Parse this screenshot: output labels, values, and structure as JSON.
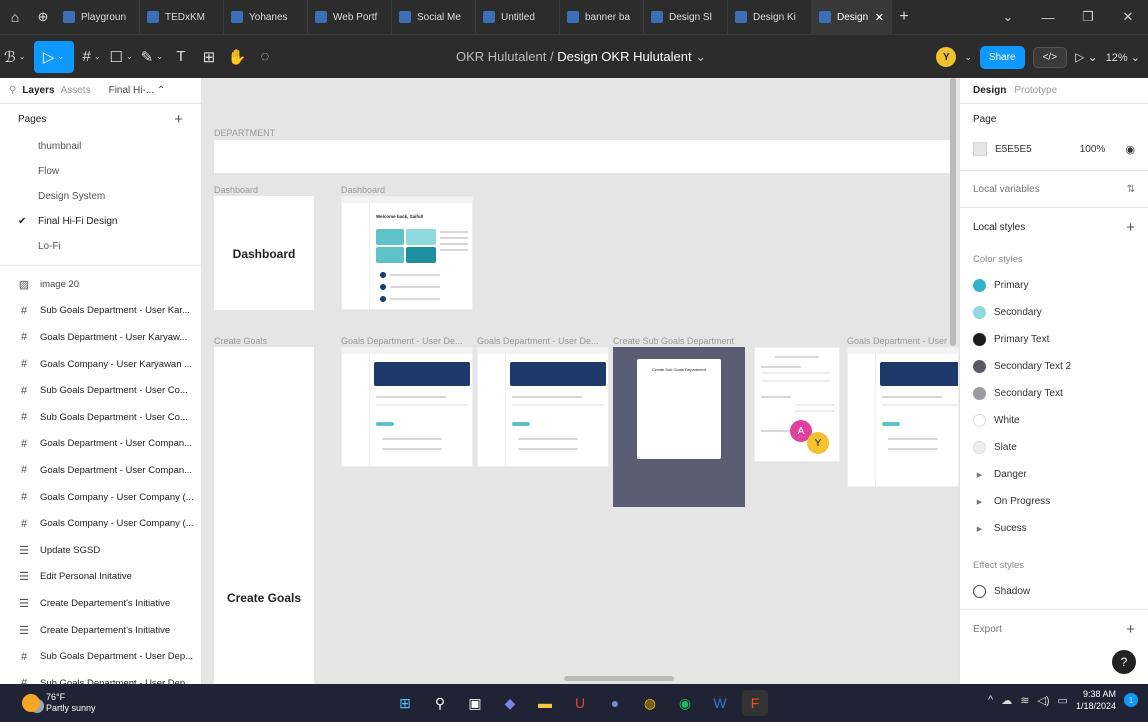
{
  "browser_tabs": [
    {
      "label": "Playgroun",
      "active": false
    },
    {
      "label": "TEDxKM",
      "active": false
    },
    {
      "label": "Yohanes",
      "active": false
    },
    {
      "label": "Web Portf",
      "active": false
    },
    {
      "label": "Social Me",
      "active": false
    },
    {
      "label": "Untitled",
      "active": false
    },
    {
      "label": "banner ba",
      "active": false
    },
    {
      "label": "Design Sl",
      "active": false
    },
    {
      "label": "Design Ki",
      "active": false
    },
    {
      "label": "Design",
      "active": true
    }
  ],
  "toolbar": {
    "project": "OKR Hulutalent",
    "separator": "/",
    "file": "Design OKR Hulutalent",
    "user_initial": "Y",
    "share_label": "Share",
    "code_label": "</>",
    "zoom": "12%"
  },
  "left_panel": {
    "tabs": {
      "layers": "Layers",
      "assets": "Assets",
      "page": "Final Hi-..."
    },
    "pages_title": "Pages",
    "pages": [
      {
        "label": "thumbnail",
        "current": false
      },
      {
        "label": "Flow",
        "current": false
      },
      {
        "label": "Design System",
        "current": false
      },
      {
        "label": "Final Hi-Fi Design",
        "current": true
      },
      {
        "label": "Lo-Fi",
        "current": false
      }
    ],
    "layers": [
      {
        "type": "image",
        "label": "image 20"
      },
      {
        "type": "frame",
        "label": "Sub Goals Department - User Kar..."
      },
      {
        "type": "frame",
        "label": "Goals Department - User Karyaw..."
      },
      {
        "type": "frame",
        "label": "Goals Company - User Karyawan ..."
      },
      {
        "type": "frame",
        "label": "Sub Goals Department - User Co..."
      },
      {
        "type": "frame",
        "label": "Sub Goals Department - User Co..."
      },
      {
        "type": "frame",
        "label": "Goals Department - User Compan..."
      },
      {
        "type": "frame",
        "label": "Goals Department - User Compan..."
      },
      {
        "type": "frame",
        "label": "Goals Company - User Company (..."
      },
      {
        "type": "frame",
        "label": "Goals Company - User Company (..."
      },
      {
        "type": "section",
        "label": "Update SGSD"
      },
      {
        "type": "section",
        "label": "Edit Personal Initative"
      },
      {
        "type": "section",
        "label": "Create Departement's Initiative"
      },
      {
        "type": "section",
        "label": "Create Departement's Initiative"
      },
      {
        "type": "frame",
        "label": "Sub Goals Department - User Dep..."
      },
      {
        "type": "frame",
        "label": "Sub Goals Department - User Dep..."
      }
    ]
  },
  "canvas": {
    "department_label": "DEPARTMENT",
    "dashboard_section_label": "Dashboard",
    "dashboard_frame_label": "Dashboard",
    "dashboard_title": "Dashboard",
    "welcome_text": "Welcome back, Saiful!",
    "create_goals_label": "Create Goals",
    "create_goals_title": "Create Goals",
    "frame_labels": [
      "Goals Department - User De...",
      "Goals Department - User De...",
      "Create Sub Goals Department",
      "Goals Department - User D"
    ],
    "modal_title": "Create Sub Goals Department",
    "cursors": {
      "a": "A",
      "y": "Y"
    }
  },
  "right_panel": {
    "tabs": {
      "design": "Design",
      "prototype": "Prototype"
    },
    "page_title": "Page",
    "page_color": "E5E5E5",
    "page_opacity": "100%",
    "local_variables": "Local variables",
    "local_styles": "Local styles",
    "color_styles_title": "Color styles",
    "color_styles": [
      {
        "name": "Primary",
        "color": "#2fb4c8",
        "group": false
      },
      {
        "name": "Secondary",
        "color": "#8fd8de",
        "group": false
      },
      {
        "name": "Primary Text",
        "color": "#1c1c1c",
        "group": false
      },
      {
        "name": "Secondary Text 2",
        "color": "#5a5a66",
        "group": false
      },
      {
        "name": "Secondary Text",
        "color": "#9a9aa2",
        "group": false
      },
      {
        "name": "White",
        "color": "#ffffff",
        "group": false
      },
      {
        "name": "Slate",
        "color": "#eeeeee",
        "group": false
      },
      {
        "name": "Danger",
        "color": "",
        "group": true
      },
      {
        "name": "On Progress",
        "color": "",
        "group": true
      },
      {
        "name": "Sucess",
        "color": "",
        "group": true
      }
    ],
    "effect_styles_title": "Effect styles",
    "effect_styles": [
      {
        "name": "Shadow"
      }
    ],
    "export": "Export",
    "help": "?"
  },
  "taskbar": {
    "temp": "76°F",
    "condition": "Partly sunny",
    "time": "9:38 AM",
    "date": "1/18/2024",
    "notif": "1"
  }
}
